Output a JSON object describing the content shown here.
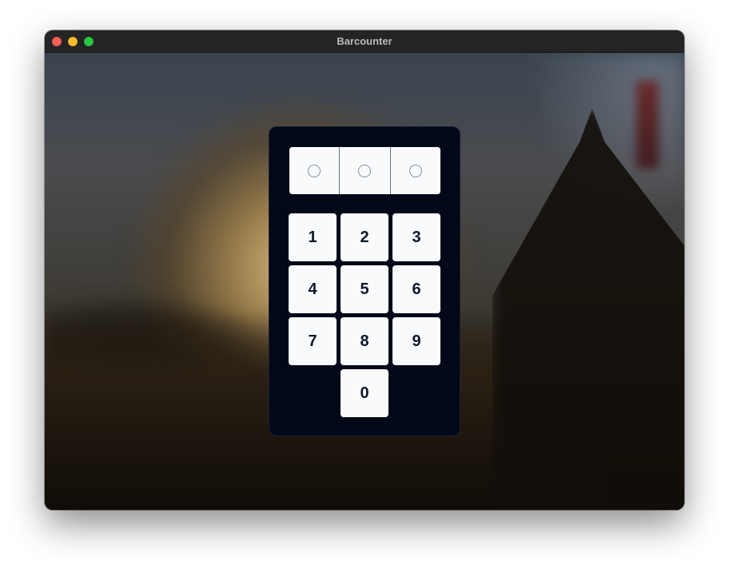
{
  "window": {
    "title": "Barcounter",
    "controls": [
      "close",
      "minimize",
      "maximize"
    ]
  },
  "pin_display": {
    "slots": [
      {
        "state": "empty",
        "icon": "circle-outline-icon"
      },
      {
        "state": "empty",
        "icon": "circle-outline-icon"
      },
      {
        "state": "empty",
        "icon": "circle-outline-icon"
      }
    ]
  },
  "keypad": {
    "keys": [
      "1",
      "2",
      "3",
      "4",
      "5",
      "6",
      "7",
      "8",
      "9",
      "0"
    ]
  },
  "colors": {
    "panel": "#020817",
    "key_background": "#f8fafc",
    "key_text": "#0f172a",
    "close": "#ff5f57",
    "minimize": "#febc2e",
    "maximize": "#28c840"
  }
}
